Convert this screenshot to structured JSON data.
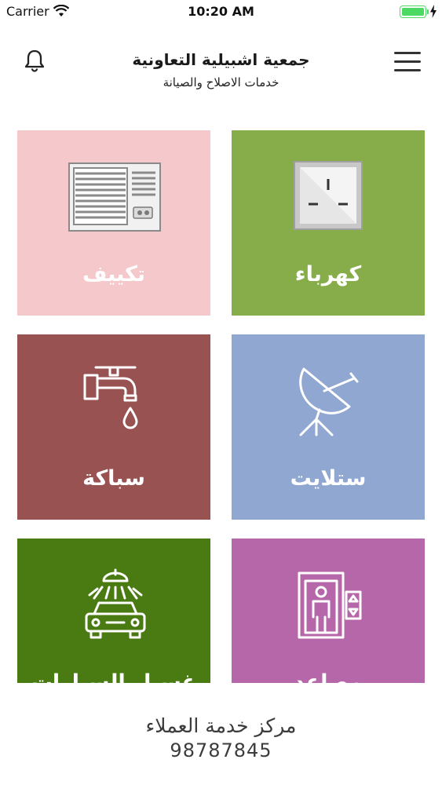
{
  "status_bar": {
    "carrier": "Carrier",
    "time": "10:20 AM",
    "battery_level": 1.0
  },
  "header": {
    "title": "جمعية اشبيلية التعاونية",
    "subtitle": "خدمات الاصلاح والصيانة",
    "bell_icon": "bell-icon",
    "menu_icon": "hamburger-menu-icon"
  },
  "services": [
    {
      "label": "تكييف",
      "color": "#f5c9cb",
      "icon": "air-conditioner-icon"
    },
    {
      "label": "كهرباء",
      "color": "#87ad4b",
      "icon": "power-socket-icon"
    },
    {
      "label": "سباكة",
      "color": "#985252",
      "icon": "water-tap-icon"
    },
    {
      "label": "ستلايت",
      "color": "#90a7d2",
      "icon": "satellite-dish-icon"
    },
    {
      "label": "غسيل السيارات",
      "color": "#497b12",
      "icon": "car-wash-icon"
    },
    {
      "label": "مصاعد",
      "color": "#b567aa",
      "icon": "elevator-icon"
    }
  ],
  "footer": {
    "title": "مركز خدمة العملاء",
    "phone": "98787845"
  }
}
